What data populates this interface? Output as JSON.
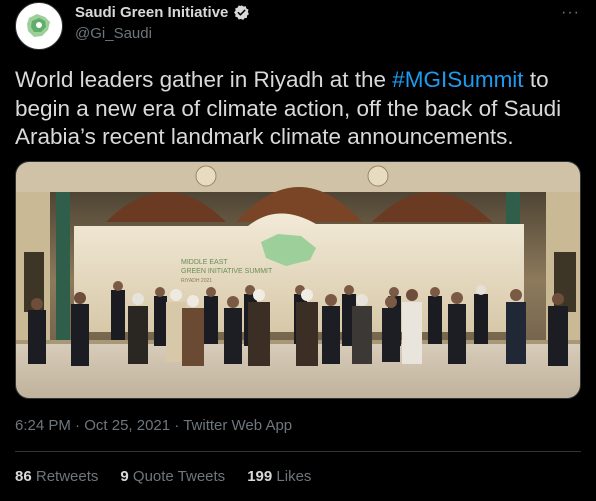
{
  "author": {
    "display_name": "Saudi Green Initiative",
    "handle": "@Gi_Saudi",
    "avatar_icon": "green-map-logo-icon",
    "verified_icon": "verified-badge-icon"
  },
  "more_label": "···",
  "tweet": {
    "text_before": "World leaders gather in Riyadh at the ",
    "hashtag": "#MGISummit",
    "text_after": " to begin a new era of climate action, off the back of Saudi Arabia’s recent landmark climate announcements."
  },
  "photo": {
    "stage_title": "MIDDLE EAST\nGREEN INITIATIVE SUMMIT",
    "stage_subtitle": "RIYADH 2021"
  },
  "meta": {
    "time": "6:24 PM",
    "separator": " · ",
    "date": "Oct 25, 2021",
    "source": "Twitter Web App"
  },
  "stats": [
    {
      "count": "86",
      "label": "Retweets"
    },
    {
      "count": "9",
      "label": "Quote Tweets"
    },
    {
      "count": "199",
      "label": "Likes"
    }
  ],
  "colors": {
    "background": "#000000",
    "text": "#d9d9d9",
    "secondary": "#6e767d",
    "link": "#1d9bf0",
    "border": "#2f3336"
  }
}
